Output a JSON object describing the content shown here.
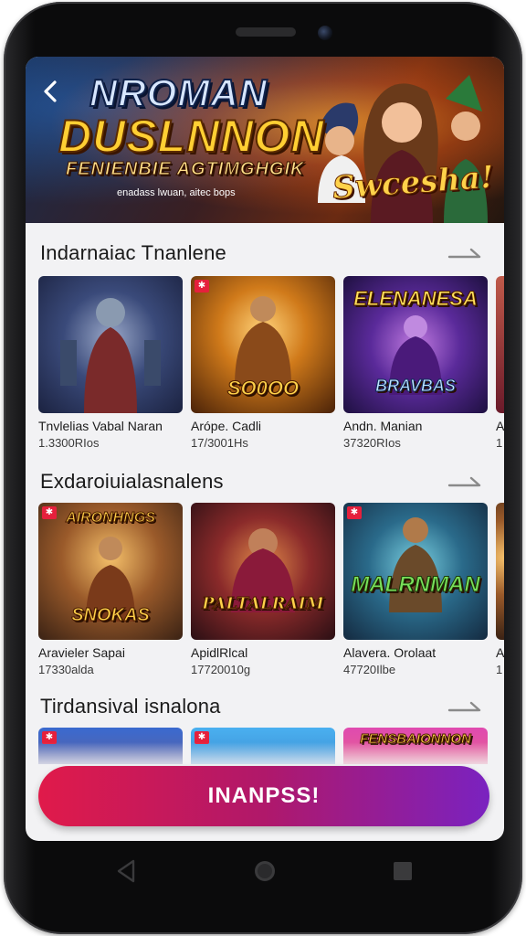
{
  "banner": {
    "title_line1": "NROMAN",
    "title_line2": "DUSLNNON",
    "subtitle": "FENIENBIE AGTIMGHGIK",
    "tagline": "enadass lwuan, aitec bops",
    "badge": "Swcesha!"
  },
  "sections": [
    {
      "title": "Indarnaiac Tnanlene",
      "cards": [
        {
          "name": "Tnvlelias Vabal Naran",
          "count": "1.3300RIos",
          "art": ""
        },
        {
          "name": "Arópe. Cadli",
          "count": "17/3001Hs",
          "art": "SO0OO"
        },
        {
          "name": "Andn. Manian",
          "count": "37320RIos",
          "art": "BRAVBAS"
        }
      ],
      "peek": {
        "name": "A",
        "count": "1"
      }
    },
    {
      "title": "Exdaroiuialasnalens",
      "cards": [
        {
          "name": "Aravieler Sapai",
          "count": "17330alda",
          "art": "SNOKAS"
        },
        {
          "name": "ApidlRlcal",
          "count": "17720010g",
          "art": "PALTALRAIM"
        },
        {
          "name": "Alavera. Orolaat",
          "count": "47720Ilbe",
          "art": "MALRNMAN"
        }
      ],
      "peek": {
        "name": "A",
        "count": "1"
      }
    },
    {
      "title": "Tirdansival isnalona",
      "cards": [
        {
          "name": "",
          "count": "",
          "art": ""
        },
        {
          "name": "",
          "count": "",
          "art": ""
        },
        {
          "name": "",
          "count": "",
          "art": "FENSBAIONNON"
        }
      ]
    }
  ],
  "cta": {
    "label": "INANPSS!"
  },
  "icons": {
    "back": "back-arrow-icon",
    "section_more": "arrow-right-icon",
    "nav_back": "triangle-back-icon",
    "nav_home": "circle-home-icon",
    "nav_recents": "square-recents-icon"
  },
  "colors": {
    "cta_start": "#e01a4a",
    "cta_end": "#7a22c0",
    "badge_red": "#e5203c"
  }
}
